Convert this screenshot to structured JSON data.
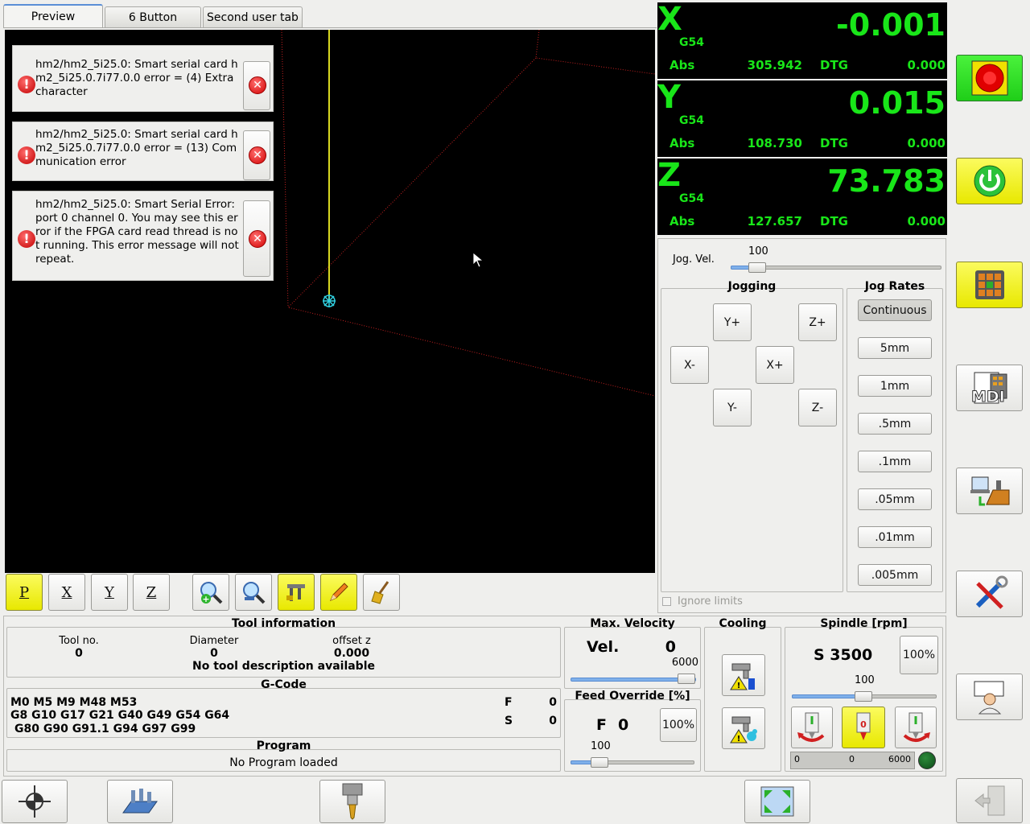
{
  "tabs": [
    {
      "label": "Preview"
    },
    {
      "label": "6 Button"
    },
    {
      "label": "Second user tab"
    }
  ],
  "notifications": [
    {
      "message": "hm2/hm2_5i25.0: Smart serial card hm2_5i25.0.7i77.0.0 error = (4) Extra character"
    },
    {
      "message": "hm2/hm2_5i25.0: Smart serial card hm2_5i25.0.7i77.0.0 error = (13) Communication error"
    },
    {
      "message": "hm2/hm2_5i25.0: Smart Serial Error: port 0 channel 0. You may see this error if the FPGA card read thread is not running. This error message will not repeat."
    }
  ],
  "dro": [
    {
      "axis": "X",
      "coord": "G54",
      "value": "-0.001",
      "abs_label": "Abs",
      "abs": "305.942",
      "dtg_label": "DTG",
      "dtg": "0.000"
    },
    {
      "axis": "Y",
      "coord": "G54",
      "value": "0.015",
      "abs_label": "Abs",
      "abs": "108.730",
      "dtg_label": "DTG",
      "dtg": "0.000"
    },
    {
      "axis": "Z",
      "coord": "G54",
      "value": "73.783",
      "abs_label": "Abs",
      "abs": "127.657",
      "dtg_label": "DTG",
      "dtg": "0.000"
    }
  ],
  "jog": {
    "vel_label": "Jog. Vel.",
    "vel_value": "100",
    "jogging_title": "Jogging",
    "rates_title": "Jog Rates",
    "buttons": {
      "y_plus": "Y+",
      "z_plus": "Z+",
      "x_minus": "X-",
      "x_plus": "X+",
      "y_minus": "Y-",
      "z_minus": "Z-"
    },
    "rates": [
      "Continuous",
      "5mm",
      "1mm",
      ".5mm",
      ".1mm",
      ".05mm",
      ".01mm",
      ".005mm"
    ],
    "ignore_limits": "Ignore limits"
  },
  "tool_info": {
    "title": "Tool information",
    "tool_no_label": "Tool no.",
    "tool_no": "0",
    "diameter_label": "Diameter",
    "diameter": "0",
    "offset_label": "offset z",
    "offset": "0.000",
    "description": "No tool description available"
  },
  "gcode": {
    "title": "G-Code",
    "line1": "M0 M5 M9 M48 M53",
    "line2": "G8 G10 G17 G21 G40 G49 G54 G64",
    "line3": "G80 G90 G91.1 G94 G97 G99",
    "f_label": "F",
    "f_value": "0",
    "s_label": "S",
    "s_value": "0"
  },
  "program": {
    "title": "Program",
    "status": "No Program loaded"
  },
  "max_velocity": {
    "title": "Max. Velocity",
    "label": "Vel.",
    "value": "0",
    "max": "6000"
  },
  "feed_override": {
    "title": "Feed Override [%]",
    "label": "F",
    "value": "0",
    "reset": "100%",
    "slider_value": "100"
  },
  "cooling": {
    "title": "Cooling"
  },
  "spindle": {
    "title": "Spindle [rpm]",
    "speed": "S 3500",
    "override_btn": "100%",
    "override_value": "100",
    "bar_min": "0",
    "bar_mid": "0",
    "bar_max": "6000"
  },
  "side_buttons": {
    "mdi_label": "MDI"
  },
  "colors": {
    "dro_text": "#19e619",
    "accent_yellow": "#f0f000",
    "estop_green": "#27d81f"
  }
}
